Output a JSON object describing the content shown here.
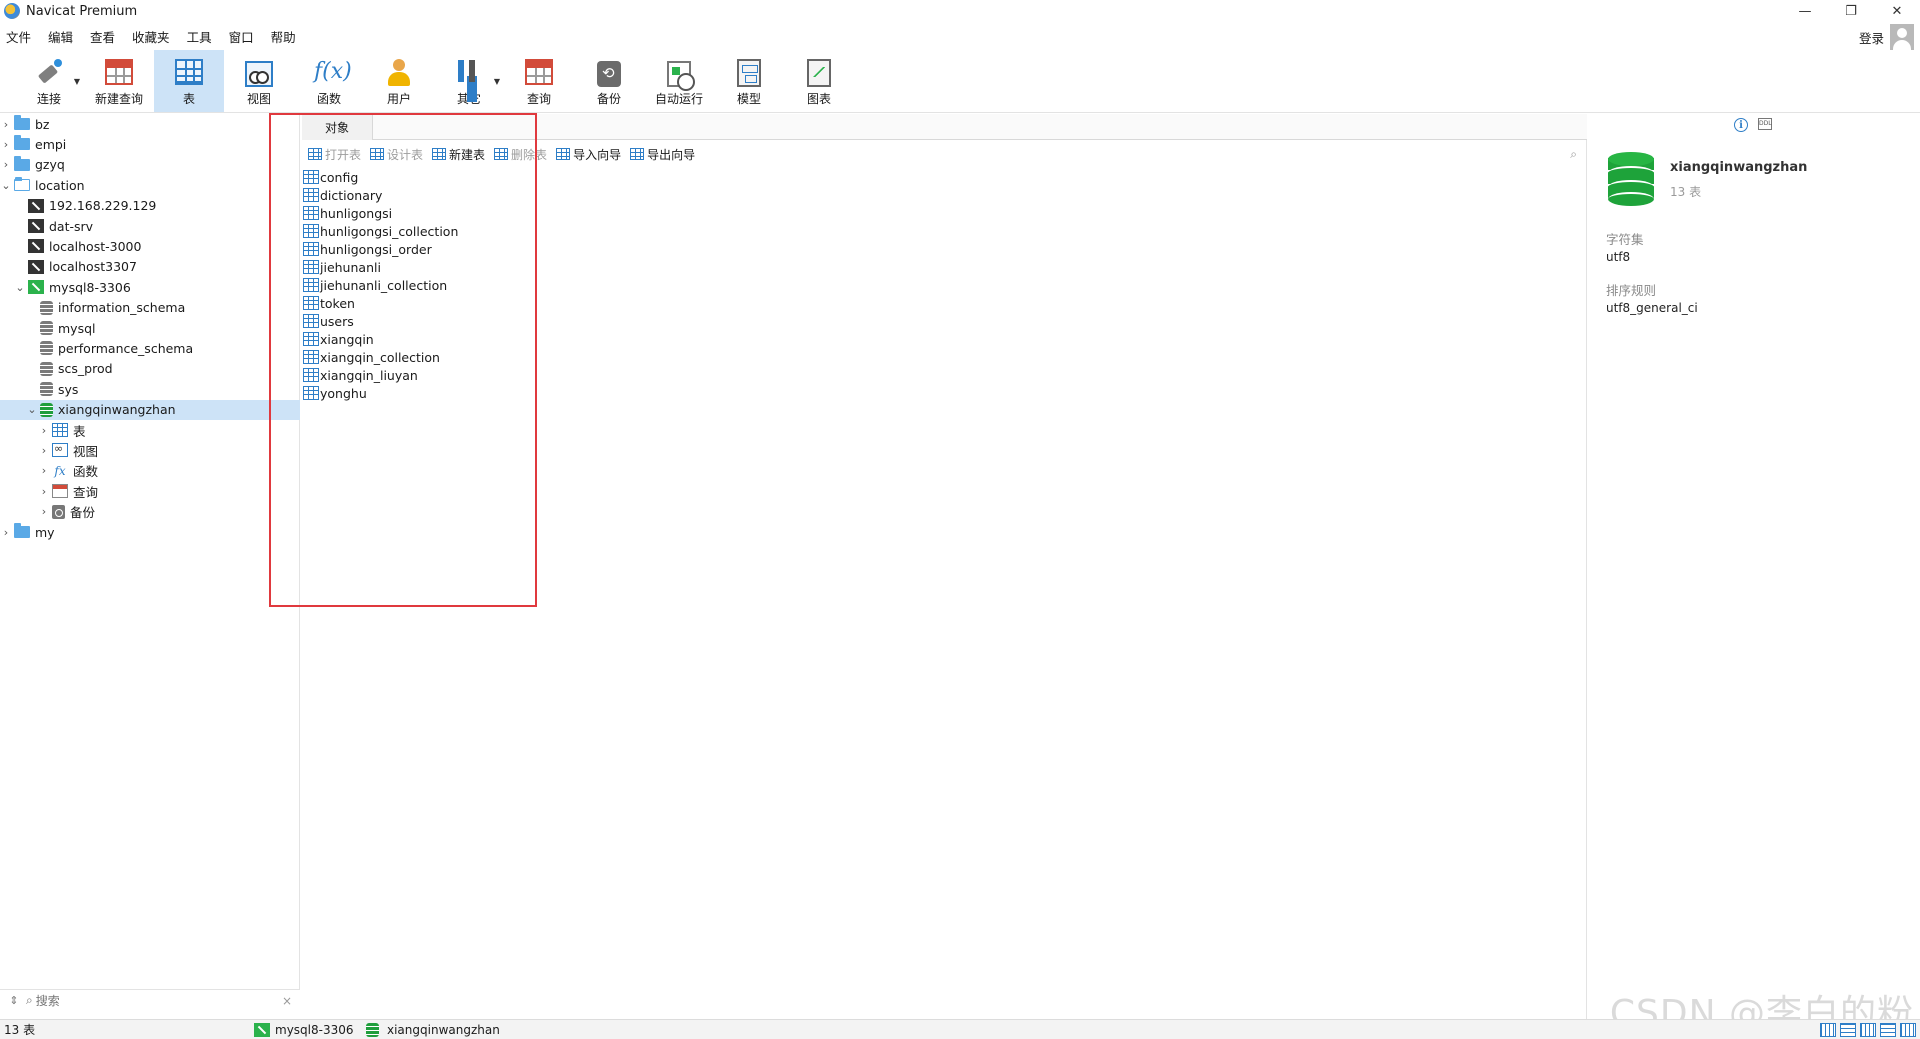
{
  "window": {
    "title": "Navicat Premium",
    "controls": [
      "—",
      "❐",
      "✕"
    ]
  },
  "menu": {
    "items": [
      "文件",
      "编辑",
      "查看",
      "收藏夹",
      "工具",
      "窗口",
      "帮助"
    ],
    "login": "登录"
  },
  "toolbar": {
    "items": [
      {
        "label": "连接",
        "icon": "connection-plug-icon"
      },
      {
        "label": "新建查询",
        "icon": "new-query-icon"
      },
      {
        "label": "表",
        "icon": "table-icon",
        "active": true
      },
      {
        "label": "视图",
        "icon": "view-icon"
      },
      {
        "label": "函数",
        "icon": "function-icon"
      },
      {
        "label": "用户",
        "icon": "user-icon"
      },
      {
        "label": "其它",
        "icon": "tools-icon"
      },
      {
        "label": "查询",
        "icon": "query-icon"
      },
      {
        "label": "备份",
        "icon": "backup-icon"
      },
      {
        "label": "自动运行",
        "icon": "automation-icon"
      },
      {
        "label": "模型",
        "icon": "model-icon"
      },
      {
        "label": "图表",
        "icon": "chart-icon"
      }
    ]
  },
  "sidebar": {
    "tree": [
      {
        "label": "bz",
        "level": 0,
        "icon": "folder",
        "chevron": "›"
      },
      {
        "label": "empi",
        "level": 0,
        "icon": "folder",
        "chevron": "›"
      },
      {
        "label": "gzyq",
        "level": 0,
        "icon": "folder",
        "chevron": "›"
      },
      {
        "label": "location",
        "level": 0,
        "icon": "folder-open",
        "chevron": "⌄"
      },
      {
        "label": "192.168.229.129",
        "level": 1,
        "icon": "connection",
        "chevron": ""
      },
      {
        "label": "dat-srv",
        "level": 1,
        "icon": "connection",
        "chevron": ""
      },
      {
        "label": "localhost-3000",
        "level": 1,
        "icon": "connection",
        "chevron": ""
      },
      {
        "label": "localhost3307",
        "level": 1,
        "icon": "connection",
        "chevron": ""
      },
      {
        "label": "mysql8-3306",
        "level": 1,
        "icon": "connection-green",
        "chevron": "⌄"
      },
      {
        "label": "information_schema",
        "level": 2,
        "icon": "database",
        "chevron": ""
      },
      {
        "label": "mysql",
        "level": 2,
        "icon": "database",
        "chevron": ""
      },
      {
        "label": "performance_schema",
        "level": 2,
        "icon": "database",
        "chevron": ""
      },
      {
        "label": "scs_prod",
        "level": 2,
        "icon": "database",
        "chevron": ""
      },
      {
        "label": "sys",
        "level": 2,
        "icon": "database",
        "chevron": ""
      },
      {
        "label": "xiangqinwangzhan",
        "level": 2,
        "icon": "database-green",
        "chevron": "⌄",
        "selected": true
      },
      {
        "label": "表",
        "level": 3,
        "icon": "table",
        "chevron": "›"
      },
      {
        "label": "视图",
        "level": 3,
        "icon": "view",
        "chevron": "›"
      },
      {
        "label": "函数",
        "level": 3,
        "icon": "function",
        "chevron": "›"
      },
      {
        "label": "查询",
        "level": 3,
        "icon": "query",
        "chevron": "›"
      },
      {
        "label": "备份",
        "level": 3,
        "icon": "backup",
        "chevron": "›"
      },
      {
        "label": "my",
        "level": 0,
        "icon": "folder",
        "chevron": "›"
      }
    ],
    "search_placeholder": "搜索",
    "clear": "×"
  },
  "center": {
    "tab": "对象",
    "actions": [
      {
        "label": "打开表",
        "enabled": false
      },
      {
        "label": "设计表",
        "enabled": false
      },
      {
        "label": "新建表",
        "enabled": true
      },
      {
        "label": "删除表",
        "enabled": false
      },
      {
        "label": "导入向导",
        "enabled": true
      },
      {
        "label": "导出向导",
        "enabled": true
      }
    ],
    "tables": [
      "config",
      "dictionary",
      "hunligongsi",
      "hunligongsi_collection",
      "hunligongsi_order",
      "jiehunanli",
      "jiehunanli_collection",
      "token",
      "users",
      "xiangqin",
      "xiangqin_collection",
      "xiangqin_liuyan",
      "yonghu"
    ]
  },
  "info_panel": {
    "db_name": "xiangqinwangzhan",
    "table_count": "13 表",
    "charset_label": "字符集",
    "charset_value": "utf8",
    "collation_label": "排序规则",
    "collation_value": "utf8_general_ci"
  },
  "statusbar": {
    "count": "13 表",
    "connection": "mysql8-3306",
    "database": "xiangqinwangzhan"
  },
  "watermark": "CSDN @李白的粉",
  "colors": {
    "accent": "#2e7ec7",
    "selection": "#cde3f7",
    "highlight_box": "#e0393e",
    "db_green": "#1ea33a"
  }
}
